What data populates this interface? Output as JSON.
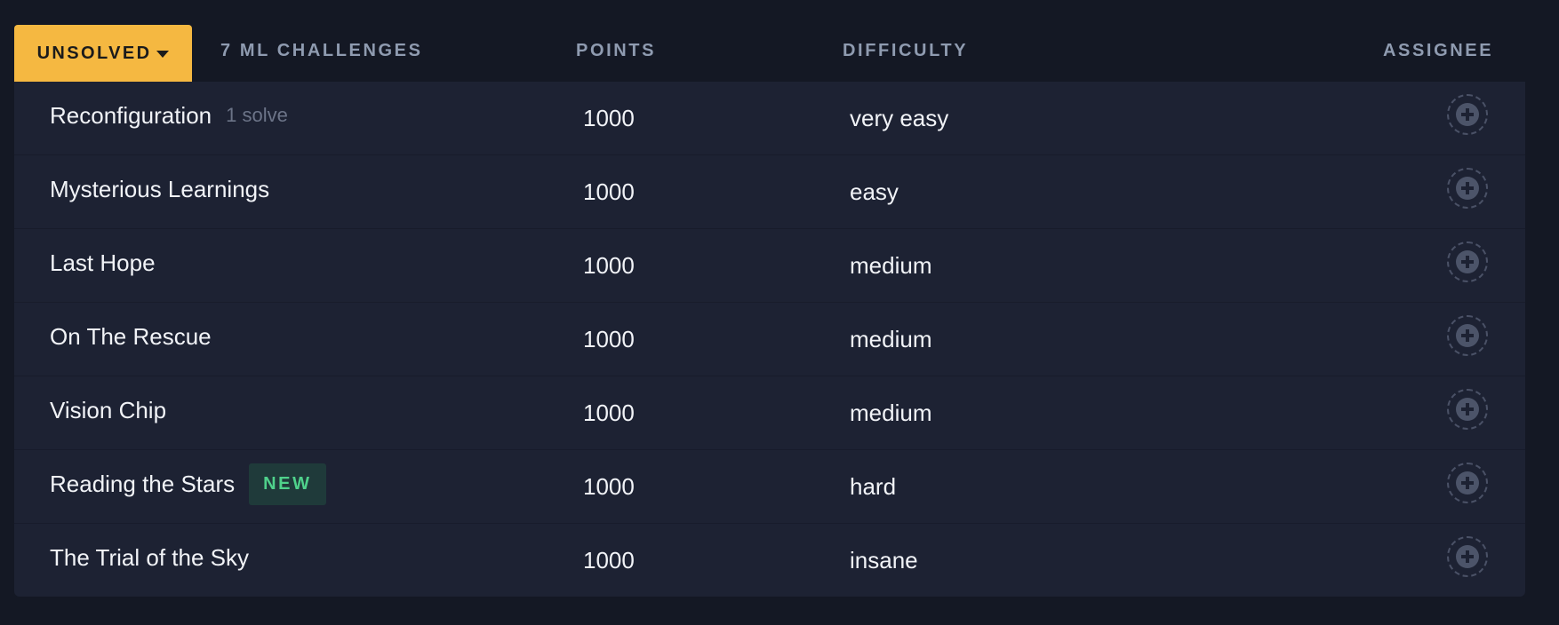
{
  "header": {
    "filter_label": "UNSOLVED",
    "count_label": "7 ML CHALLENGES",
    "points_label": "POINTS",
    "difficulty_label": "DIFFICULTY",
    "assignee_label": "ASSIGNEE"
  },
  "colors": {
    "accent": "#f5b841",
    "new_badge_text": "#4fd18b",
    "background": "#141824",
    "table": "#1d2233"
  },
  "challenges": [
    {
      "name": "Reconfiguration",
      "solves": "1 solve",
      "points": "1000",
      "difficulty": "very easy"
    },
    {
      "name": "Mysterious Learnings",
      "points": "1000",
      "difficulty": "easy"
    },
    {
      "name": "Last Hope",
      "points": "1000",
      "difficulty": "medium"
    },
    {
      "name": "On The Rescue",
      "points": "1000",
      "difficulty": "medium"
    },
    {
      "name": "Vision Chip",
      "points": "1000",
      "difficulty": "medium"
    },
    {
      "name": "Reading the Stars",
      "badge": "NEW",
      "points": "1000",
      "difficulty": "hard"
    },
    {
      "name": "The Trial of the Sky",
      "points": "1000",
      "difficulty": "insane"
    }
  ],
  "icons": {
    "filter_caret": "caret-down-icon",
    "assign": "add-assignee-icon"
  }
}
